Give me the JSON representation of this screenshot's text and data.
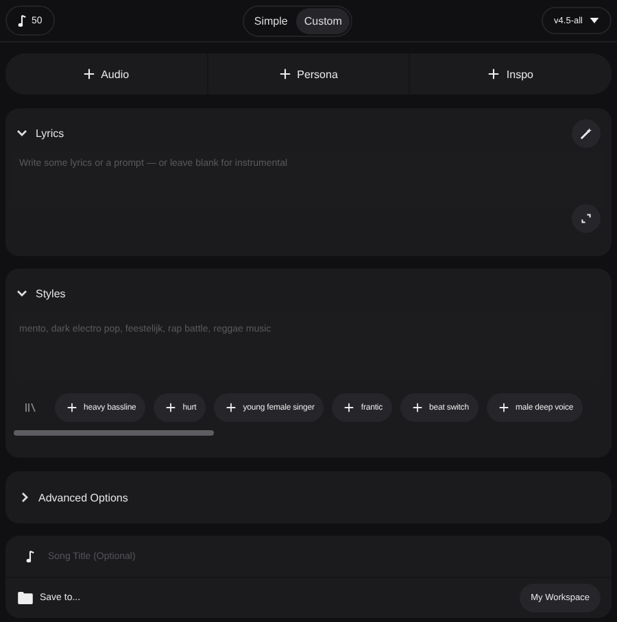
{
  "credits": {
    "count": "50"
  },
  "mode_tabs": [
    {
      "label": "Simple",
      "selected": false
    },
    {
      "label": "Custom",
      "selected": true
    }
  ],
  "model": {
    "label": "v4.5-all"
  },
  "add_buttons": [
    {
      "label": "Audio"
    },
    {
      "label": "Persona"
    },
    {
      "label": "Inspo"
    }
  ],
  "lyrics": {
    "title": "Lyrics",
    "expanded": true,
    "placeholder": "Write some lyrics or a prompt — or leave blank for instrumental"
  },
  "styles": {
    "title": "Styles",
    "expanded": true,
    "placeholder": "mento, dark electro pop, feestelijk, rap battle, reggae music",
    "tags": [
      {
        "label": "heavy bassline"
      },
      {
        "label": "hurt"
      },
      {
        "label": "young female singer"
      },
      {
        "label": "frantic"
      },
      {
        "label": "beat switch"
      },
      {
        "label": "male deep voice"
      }
    ]
  },
  "advanced": {
    "title": "Advanced Options",
    "expanded": false
  },
  "song_title": {
    "placeholder": "Song Title (Optional)"
  },
  "save": {
    "label": "Save to...",
    "workspace": "My Workspace"
  }
}
